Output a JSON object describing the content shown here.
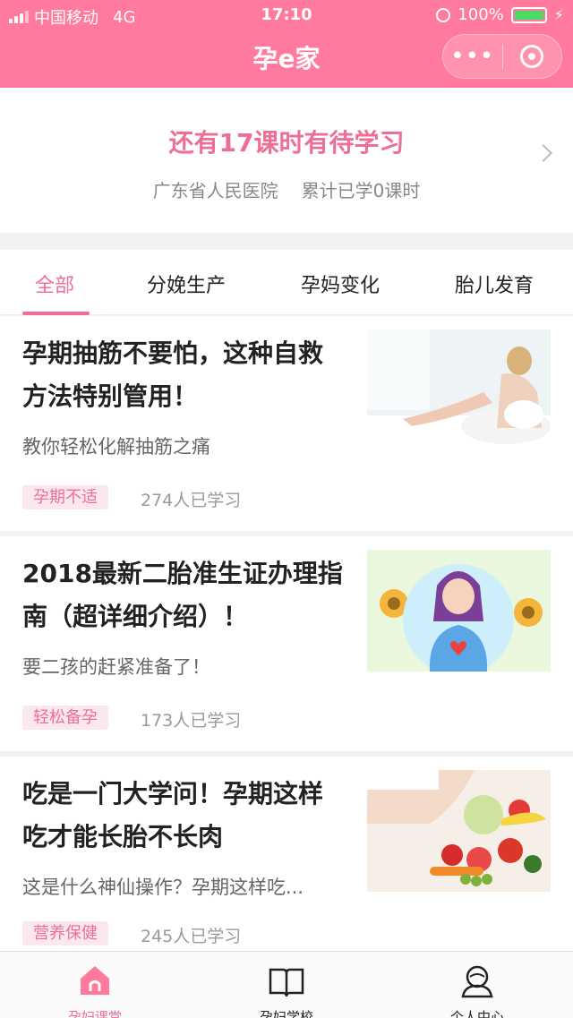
{
  "status_bar": {
    "carrier": "中国移动",
    "network": "4G",
    "time": "17:10",
    "battery": "100%"
  },
  "header": {
    "title": "孕e家",
    "more": "•••"
  },
  "summary": {
    "headline": "还有17课时有待学习",
    "hospital": "广东省人民医院",
    "progress": "累计已学0课时"
  },
  "tabs": [
    {
      "label": "全部"
    },
    {
      "label": "分娩生产"
    },
    {
      "label": "孕妈变化"
    },
    {
      "label": "胎儿发育"
    }
  ],
  "articles": [
    {
      "title": "孕期抽筋不要怕，这种自救方法特别管用！",
      "desc": "教你轻松化解抽筋之痛",
      "tag": "孕期不适",
      "count": "274人已学习"
    },
    {
      "title": "2018最新二胎准生证办理指南（超详细介绍）！",
      "desc": "要二孩的赶紧准备了！",
      "tag": "轻松备孕",
      "count": "173人已学习"
    },
    {
      "title": "吃是一门大学问！孕期这样吃才能长胎不长肉",
      "desc": "这是什么神仙操作？孕期这样吃...",
      "tag": "营养保健",
      "count": "245人已学习"
    }
  ],
  "bottom_nav": [
    {
      "label": "孕妇课堂",
      "icon": "house-icon"
    },
    {
      "label": "孕妇学校",
      "icon": "book-icon"
    },
    {
      "label": "个人中心",
      "icon": "person-icon"
    }
  ],
  "colors": {
    "brand": "#ff7a9c",
    "accent": "#ee6f95",
    "tag_bg": "#fbe7ef"
  }
}
